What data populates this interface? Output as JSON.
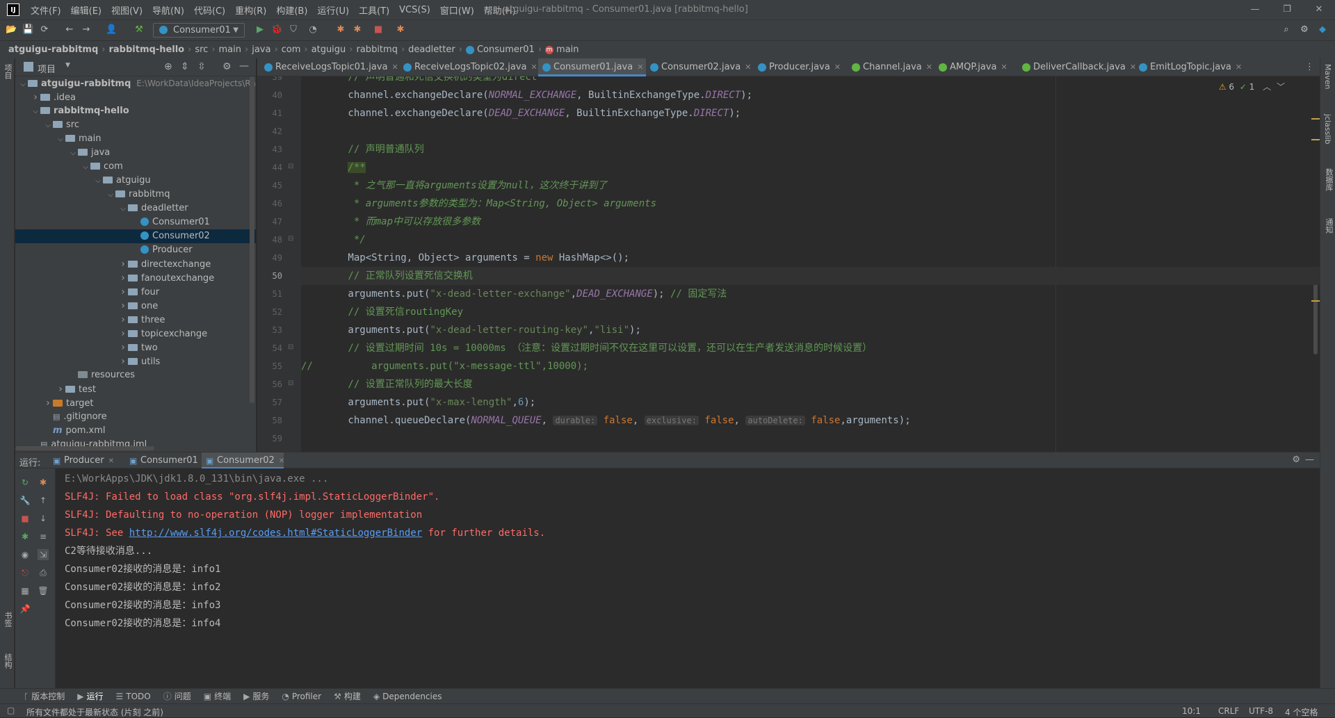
{
  "titlebar": {
    "menus": [
      "文件(F)",
      "编辑(E)",
      "视图(V)",
      "导航(N)",
      "代码(C)",
      "重构(R)",
      "构建(B)",
      "运行(U)",
      "工具(T)",
      "VCS(S)",
      "窗口(W)",
      "帮助(H)"
    ],
    "title": "atguigu-rabbitmq - Consumer01.java [rabbitmq-hello]"
  },
  "toolbar": {
    "run_config": "Consumer01"
  },
  "breadcrumb": [
    "atguigu-rabbitmq",
    "rabbitmq-hello",
    "src",
    "main",
    "java",
    "com",
    "atguigu",
    "rabbitmq",
    "deadletter",
    "Consumer01",
    "main"
  ],
  "project": {
    "header": "项目",
    "tree": [
      {
        "label": "atguigu-rabbitmq",
        "extra": "E:\\WorkData\\IdeaProjects\\Ra",
        "depth": 0,
        "arrow": "down",
        "type": "folder",
        "bold": true
      },
      {
        "label": ".idea",
        "depth": 1,
        "arrow": "right",
        "type": "folder"
      },
      {
        "label": "rabbitmq-hello",
        "depth": 1,
        "arrow": "down",
        "type": "folder",
        "bold": true
      },
      {
        "label": "src",
        "depth": 2,
        "arrow": "down",
        "type": "folder"
      },
      {
        "label": "main",
        "depth": 3,
        "arrow": "down",
        "type": "folder"
      },
      {
        "label": "java",
        "depth": 4,
        "arrow": "down",
        "type": "folder"
      },
      {
        "label": "com",
        "depth": 5,
        "arrow": "down",
        "type": "folder"
      },
      {
        "label": "atguigu",
        "depth": 6,
        "arrow": "down",
        "type": "folder"
      },
      {
        "label": "rabbitmq",
        "depth": 7,
        "arrow": "down",
        "type": "folder"
      },
      {
        "label": "deadletter",
        "depth": 8,
        "arrow": "down",
        "type": "folder"
      },
      {
        "label": "Consumer01",
        "depth": 9,
        "arrow": "",
        "type": "class"
      },
      {
        "label": "Consumer02",
        "depth": 9,
        "arrow": "",
        "type": "class",
        "selected": true
      },
      {
        "label": "Producer",
        "depth": 9,
        "arrow": "",
        "type": "class"
      },
      {
        "label": "directexchange",
        "depth": 8,
        "arrow": "right",
        "type": "folder"
      },
      {
        "label": "fanoutexchange",
        "depth": 8,
        "arrow": "right",
        "type": "folder"
      },
      {
        "label": "four",
        "depth": 8,
        "arrow": "right",
        "type": "folder"
      },
      {
        "label": "one",
        "depth": 8,
        "arrow": "right",
        "type": "folder"
      },
      {
        "label": "three",
        "depth": 8,
        "arrow": "right",
        "type": "folder"
      },
      {
        "label": "topicexchange",
        "depth": 8,
        "arrow": "right",
        "type": "folder"
      },
      {
        "label": "two",
        "depth": 8,
        "arrow": "right",
        "type": "folder"
      },
      {
        "label": "utils",
        "depth": 8,
        "arrow": "right",
        "type": "folder"
      },
      {
        "label": "resources",
        "depth": 4,
        "arrow": "",
        "type": "folder-gray"
      },
      {
        "label": "test",
        "depth": 3,
        "arrow": "right",
        "type": "folder"
      },
      {
        "label": "target",
        "depth": 2,
        "arrow": "right",
        "type": "folder-orange"
      },
      {
        "label": ".gitignore",
        "depth": 2,
        "arrow": "",
        "type": "file"
      },
      {
        "label": "pom.xml",
        "depth": 2,
        "arrow": "",
        "type": "maven"
      },
      {
        "label": "atguigu-rabbitmq.iml",
        "depth": 1,
        "arrow": "",
        "type": "file"
      }
    ]
  },
  "editor_tabs": [
    {
      "label": "ReceiveLogsTopic01.java",
      "icon": "class"
    },
    {
      "label": "ReceiveLogsTopic02.java",
      "icon": "class"
    },
    {
      "label": "Consumer01.java",
      "icon": "class",
      "active": true
    },
    {
      "label": "Consumer02.java",
      "icon": "class"
    },
    {
      "label": "Producer.java",
      "icon": "class"
    },
    {
      "label": "Channel.java",
      "icon": "interface"
    },
    {
      "label": "AMQP.java",
      "icon": "interface"
    },
    {
      "label": "DeliverCallback.java",
      "icon": "interface"
    },
    {
      "label": "EmitLogTopic.java",
      "icon": "class"
    }
  ],
  "inspections": {
    "warnings": "6",
    "ok": "1"
  },
  "code": {
    "line_numbers": [
      "39",
      "40",
      "41",
      "42",
      "43",
      "44",
      "45",
      "46",
      "47",
      "48",
      "49",
      "50",
      "51",
      "52",
      "53",
      "54",
      "55",
      "56",
      "57",
      "58",
      "59"
    ],
    "current_line": "50",
    "lines": [
      [
        {
          "t": "        // 声明普通和死信交换机的类型为direct",
          "c": "cm2"
        }
      ],
      [
        {
          "t": "        channel.exchangeDeclare(",
          "c": ""
        },
        {
          "t": "NORMAL_EXCHANGE",
          "c": "cn"
        },
        {
          "t": ", BuiltinExchangeType.",
          "c": ""
        },
        {
          "t": "DIRECT",
          "c": "cn"
        },
        {
          "t": ");",
          "c": ""
        }
      ],
      [
        {
          "t": "        channel.exchangeDeclare(",
          "c": ""
        },
        {
          "t": "DEAD_EXCHANGE",
          "c": "cn"
        },
        {
          "t": ", BuiltinExchangeType.",
          "c": ""
        },
        {
          "t": "DIRECT",
          "c": "cn"
        },
        {
          "t": ");",
          "c": ""
        }
      ],
      [
        {
          "t": "",
          "c": ""
        }
      ],
      [
        {
          "t": "        // 声明普通队列",
          "c": "cm2"
        }
      ],
      [
        {
          "t": "        ",
          "c": ""
        },
        {
          "t": "/**",
          "c": "javadoc"
        }
      ],
      [
        {
          "t": "         * 之气那一直将arguments设置为null，这次终于讲到了",
          "c": "javadoc"
        }
      ],
      [
        {
          "t": "         * arguments参数的类型为：Map<String, Object> arguments",
          "c": "javadoc"
        }
      ],
      [
        {
          "t": "         * 而map中可以存放很多参数",
          "c": "javadoc"
        }
      ],
      [
        {
          "t": "         */",
          "c": "javadoc"
        }
      ],
      [
        {
          "t": "        Map<String, Object> arguments = ",
          "c": ""
        },
        {
          "t": "new",
          "c": "kw"
        },
        {
          "t": " HashMap<>();",
          "c": ""
        }
      ],
      [
        {
          "t": "        // 正常队列设置死信交换机",
          "c": "cm2"
        }
      ],
      [
        {
          "t": "        arguments.put(",
          "c": ""
        },
        {
          "t": "\"x-dead-letter-exchange\"",
          "c": "st"
        },
        {
          "t": ",",
          "c": ""
        },
        {
          "t": "DEAD_EXCHANGE",
          "c": "cn"
        },
        {
          "t": "); ",
          "c": ""
        },
        {
          "t": "// 固定写法",
          "c": "cm2"
        }
      ],
      [
        {
          "t": "        // 设置死信routingKey",
          "c": "cm2"
        }
      ],
      [
        {
          "t": "        arguments.put(",
          "c": ""
        },
        {
          "t": "\"x-dead-letter-routing-key\"",
          "c": "st"
        },
        {
          "t": ",",
          "c": ""
        },
        {
          "t": "\"lisi\"",
          "c": "st"
        },
        {
          "t": ");",
          "c": ""
        }
      ],
      [
        {
          "t": "        // 设置过期时间 10s = 10000ms （注意：设置过期时间不仅在这里可以设置，还可以在生产者发送消息的时候设置）",
          "c": "cm2"
        }
      ],
      [
        {
          "t": "//          arguments.put(\"x-message-ttl\",10000);",
          "c": "cm2"
        }
      ],
      [
        {
          "t": "        // 设置正常队列的最大长度",
          "c": "cm2"
        }
      ],
      [
        {
          "t": "        arguments.put(",
          "c": ""
        },
        {
          "t": "\"x-max-length\"",
          "c": "st"
        },
        {
          "t": ",",
          "c": ""
        },
        {
          "t": "6",
          "c": "nu"
        },
        {
          "t": ");",
          "c": ""
        }
      ],
      [
        {
          "t": "        channel.queueDeclare(",
          "c": ""
        },
        {
          "t": "NORMAL_QUEUE",
          "c": "cn"
        },
        {
          "t": ", ",
          "c": ""
        },
        {
          "t": "durable:",
          "c": "hint"
        },
        {
          "t": " ",
          "c": ""
        },
        {
          "t": "false",
          "c": "kw"
        },
        {
          "t": ", ",
          "c": ""
        },
        {
          "t": "exclusive:",
          "c": "hint"
        },
        {
          "t": " ",
          "c": ""
        },
        {
          "t": "false",
          "c": "kw"
        },
        {
          "t": ", ",
          "c": ""
        },
        {
          "t": "autoDelete:",
          "c": "hint"
        },
        {
          "t": " ",
          "c": ""
        },
        {
          "t": "false",
          "c": "kw"
        },
        {
          "t": ",arguments);",
          "c": ""
        }
      ],
      [
        {
          "t": "",
          "c": ""
        }
      ]
    ]
  },
  "run": {
    "label": "运行:",
    "tabs": [
      {
        "label": "Producer"
      },
      {
        "label": "Consumer01"
      },
      {
        "label": "Consumer02",
        "active": true
      }
    ],
    "console": [
      {
        "text": "E:\\WorkApps\\JDK\\jdk1.8.0_131\\bin\\java.exe ...",
        "kind": "gray"
      },
      {
        "text": "SLF4J: Failed to load class \"org.slf4j.impl.StaticLoggerBinder\".",
        "kind": "err"
      },
      {
        "text": "SLF4J: Defaulting to no-operation (NOP) logger implementation",
        "kind": "err"
      },
      {
        "text": "SLF4J: See ",
        "kind": "err",
        "link": "http://www.slf4j.org/codes.html#StaticLoggerBinder",
        "after": " for further details."
      },
      {
        "text": "C2等待接收消息...",
        "kind": "normal"
      },
      {
        "text": "Consumer02接收的消息是：info1",
        "kind": "normal"
      },
      {
        "text": "Consumer02接收的消息是：info2",
        "kind": "normal"
      },
      {
        "text": "Consumer02接收的消息是：info3",
        "kind": "normal"
      },
      {
        "text": "Consumer02接收的消息是：info4",
        "kind": "normal"
      }
    ]
  },
  "bottom_tools": [
    "版本控制",
    "运行",
    "TODO",
    "问题",
    "终端",
    "服务",
    "Profiler",
    "构建",
    "Dependencies"
  ],
  "status": {
    "message": "所有文件都处于最新状态 (片刻 之前)",
    "position": "10:1",
    "line_sep": "CRLF",
    "encoding": "UTF-8",
    "indent": "4 个空格"
  },
  "right_tools": [
    "Maven",
    "jclasslib",
    "数据库",
    "通知"
  ],
  "left_tools": [
    "项目",
    "书签",
    "结构"
  ]
}
